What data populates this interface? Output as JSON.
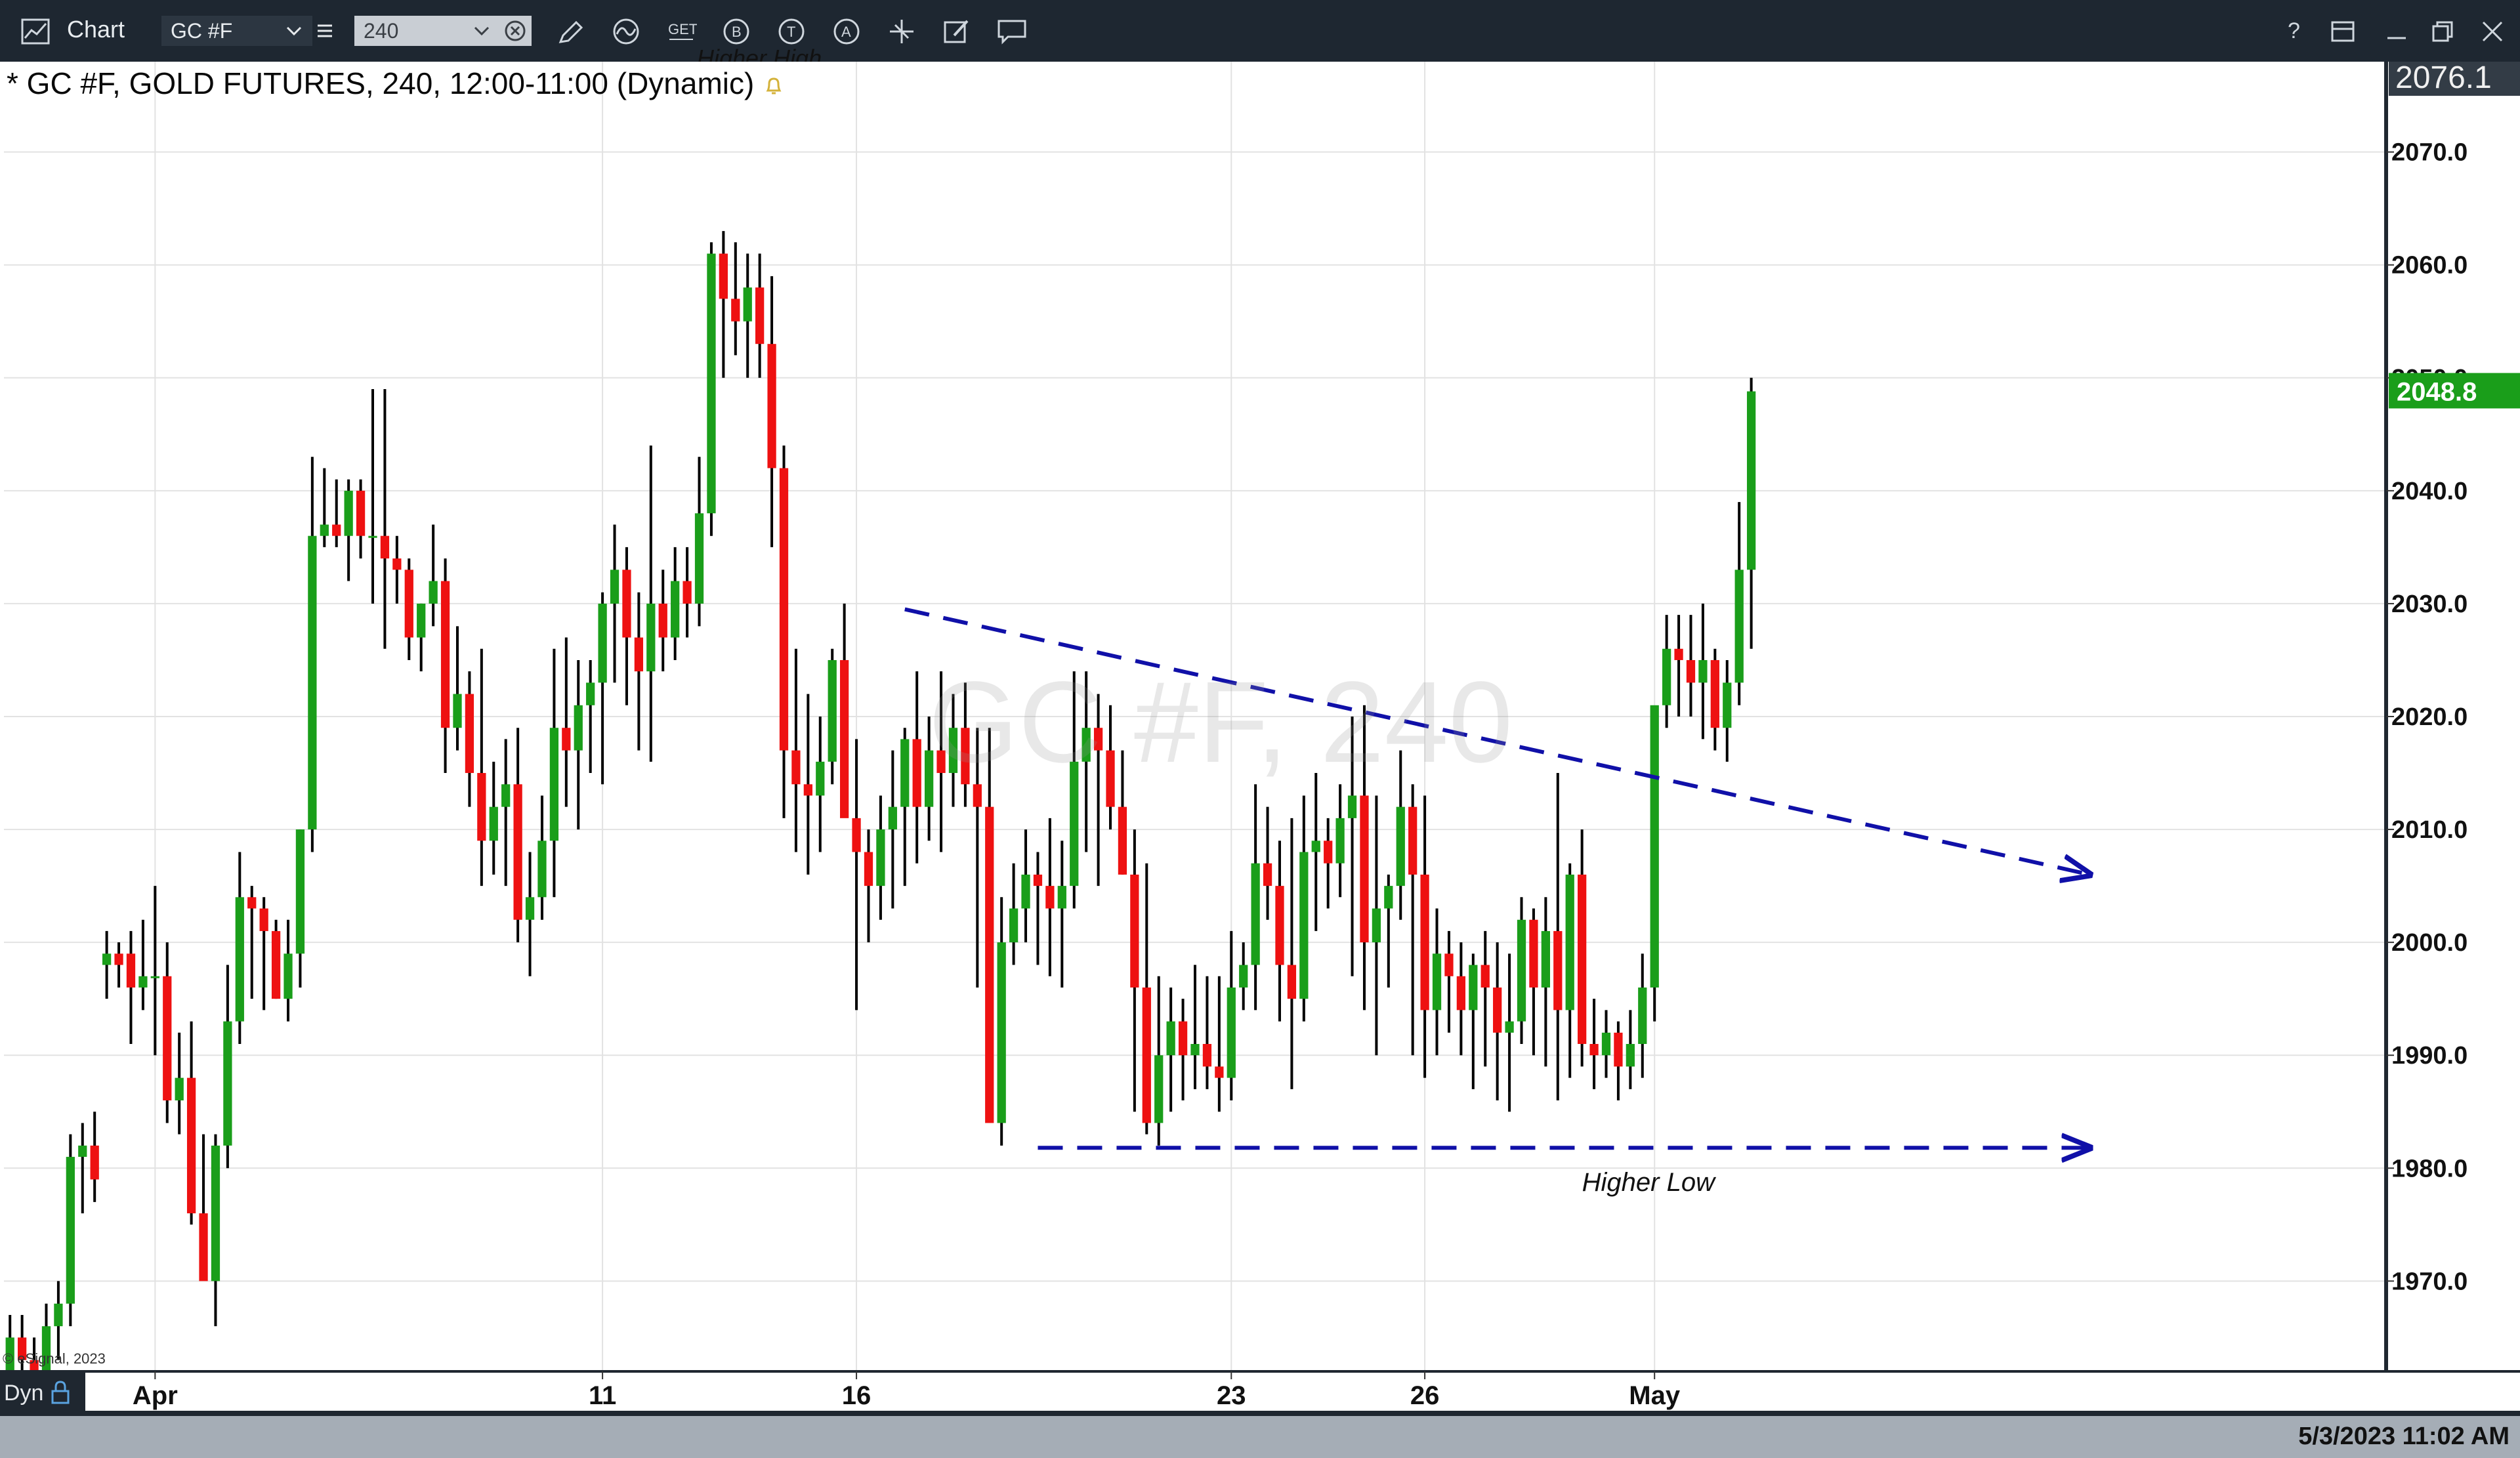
{
  "toolbar": {
    "title": "Chart",
    "symbol": "GC #F",
    "interval": "240",
    "tools": [
      "pencil-icon",
      "wave-icon",
      "get-icon",
      "b-circle-icon",
      "t-circle-icon",
      "a-circle-icon",
      "crosshair-icon",
      "edit-icon",
      "comment-icon"
    ],
    "get_label": "GET",
    "b_label": "B",
    "t_label": "T",
    "a_label": "A",
    "help_label": "?"
  },
  "chart_title": "* GC #F, GOLD FUTURES, 240, 12:00-11:00 (Dynamic)",
  "cutoff_annotation": "Higher High",
  "watermark": "GC #F, 240",
  "copyright": "© eSignal, 2023",
  "dyn_label": "Dyn",
  "timestamp": "5/3/2023 11:02 AM",
  "chart_data": {
    "type": "candlestick",
    "timeframe": "240",
    "price_axis": {
      "ylim": [
        1962,
        2078
      ],
      "ticks": [
        "1970.0",
        "1980.0",
        "1990.0",
        "2000.0",
        "2010.0",
        "2020.0",
        "2030.0",
        "2040.0",
        "2050.0",
        "2060.0",
        "2070.0"
      ],
      "top_partial_label": "2076.1",
      "last_price_label": "2048.8",
      "last_price": 2048.8
    },
    "x_axis": {
      "labels": [
        {
          "text": "Apr",
          "bar": 12
        },
        {
          "text": "11",
          "bar": 49
        },
        {
          "text": "16",
          "bar": 70
        },
        {
          "text": "23",
          "bar": 101
        },
        {
          "text": "26",
          "bar": 117
        },
        {
          "text": "May",
          "bar": 136
        }
      ],
      "total_slots": 197
    },
    "colors": {
      "up": "#1a9e1a",
      "down": "#ee1111",
      "wick": "#000000",
      "trendline": "#1010a8",
      "last_price_bg": "#1a9e1a"
    },
    "candles": [
      [
        1962,
        1967,
        1961,
        1965
      ],
      [
        1965,
        1967,
        1962,
        1963
      ],
      [
        1963,
        1965,
        1960,
        1962
      ],
      [
        1962,
        1968,
        1960,
        1966
      ],
      [
        1966,
        1970,
        1963,
        1968
      ],
      [
        1968,
        1983,
        1966,
        1981
      ],
      [
        1981,
        1984,
        1976,
        1982
      ],
      [
        1982,
        1985,
        1977,
        1979
      ],
      [
        1998,
        2001,
        1995,
        1999
      ],
      [
        1999,
        2000,
        1996,
        1998
      ],
      [
        1999,
        2001,
        1991,
        1996
      ],
      [
        1996,
        2002,
        1994,
        1997
      ],
      [
        1997,
        2005,
        1990,
        1997
      ],
      [
        1997,
        2000,
        1984,
        1986
      ],
      [
        1986,
        1992,
        1983,
        1988
      ],
      [
        1988,
        1993,
        1975,
        1976
      ],
      [
        1976,
        1983,
        1972,
        1970
      ],
      [
        1970,
        1983,
        1966,
        1982
      ],
      [
        1982,
        1998,
        1980,
        1993
      ],
      [
        1993,
        2008,
        1991,
        2004
      ],
      [
        2004,
        2005,
        1995,
        2003
      ],
      [
        2003,
        2004,
        1994,
        2001
      ],
      [
        2001,
        2002,
        1995,
        1995
      ],
      [
        1995,
        2002,
        1993,
        1999
      ],
      [
        1999,
        2010,
        1996,
        2010
      ],
      [
        2010,
        2043,
        2008,
        2036
      ],
      [
        2036,
        2042,
        2035,
        2037
      ],
      [
        2037,
        2041,
        2035,
        2036
      ],
      [
        2036,
        2041,
        2032,
        2040
      ],
      [
        2040,
        2041,
        2034,
        2036
      ],
      [
        2036,
        2049,
        2030,
        2036
      ],
      [
        2036,
        2049,
        2026,
        2034
      ],
      [
        2034,
        2036,
        2030,
        2033
      ],
      [
        2033,
        2034,
        2025,
        2027
      ],
      [
        2027,
        2030,
        2024,
        2030
      ],
      [
        2030,
        2037,
        2028,
        2032
      ],
      [
        2032,
        2034,
        2015,
        2019
      ],
      [
        2019,
        2028,
        2017,
        2022
      ],
      [
        2022,
        2024,
        2012,
        2015
      ],
      [
        2015,
        2026,
        2005,
        2009
      ],
      [
        2009,
        2016,
        2006,
        2012
      ],
      [
        2012,
        2018,
        2005,
        2014
      ],
      [
        2014,
        2019,
        2000,
        2002
      ],
      [
        2002,
        2008,
        1997,
        2004
      ],
      [
        2004,
        2013,
        2002,
        2009
      ],
      [
        2009,
        2026,
        2004,
        2019
      ],
      [
        2019,
        2027,
        2012,
        2017
      ],
      [
        2017,
        2025,
        2010,
        2021
      ],
      [
        2021,
        2025,
        2015,
        2023
      ],
      [
        2023,
        2031,
        2014,
        2030
      ],
      [
        2030,
        2037,
        2023,
        2033
      ],
      [
        2033,
        2035,
        2021,
        2027
      ],
      [
        2027,
        2031,
        2017,
        2024
      ],
      [
        2024,
        2044,
        2016,
        2030
      ],
      [
        2030,
        2033,
        2024,
        2027
      ],
      [
        2027,
        2035,
        2025,
        2032
      ],
      [
        2032,
        2035,
        2027,
        2030
      ],
      [
        2030,
        2043,
        2028,
        2038
      ],
      [
        2038,
        2062,
        2036,
        2061
      ],
      [
        2061,
        2063,
        2050,
        2057
      ],
      [
        2057,
        2062,
        2052,
        2055
      ],
      [
        2055,
        2061,
        2050,
        2058
      ],
      [
        2058,
        2061,
        2050,
        2053
      ],
      [
        2053,
        2059,
        2035,
        2042
      ],
      [
        2042,
        2044,
        2011,
        2017
      ],
      [
        2017,
        2026,
        2008,
        2014
      ],
      [
        2014,
        2022,
        2006,
        2013
      ],
      [
        2013,
        2020,
        2008,
        2016
      ],
      [
        2016,
        2026,
        2014,
        2025
      ],
      [
        2025,
        2030,
        2015,
        2011
      ],
      [
        2011,
        2018,
        1994,
        2008
      ],
      [
        2008,
        2010,
        2000,
        2005
      ],
      [
        2005,
        2013,
        2002,
        2010
      ],
      [
        2010,
        2017,
        2003,
        2012
      ],
      [
        2012,
        2019,
        2005,
        2018
      ],
      [
        2018,
        2024,
        2007,
        2012
      ],
      [
        2012,
        2020,
        2009,
        2017
      ],
      [
        2017,
        2024,
        2008,
        2015
      ],
      [
        2015,
        2022,
        2012,
        2019
      ],
      [
        2019,
        2023,
        2012,
        2014
      ],
      [
        2014,
        2019,
        1996,
        2012
      ],
      [
        2012,
        2019,
        1985,
        1984
      ],
      [
        1984,
        2004,
        1982,
        2000
      ],
      [
        2000,
        2007,
        1998,
        2003
      ],
      [
        2003,
        2010,
        2000,
        2006
      ],
      [
        2006,
        2008,
        1998,
        2005
      ],
      [
        2005,
        2011,
        1997,
        2003
      ],
      [
        2003,
        2009,
        1996,
        2005
      ],
      [
        2005,
        2024,
        2003,
        2016
      ],
      [
        2016,
        2024,
        2008,
        2019
      ],
      [
        2019,
        2022,
        2005,
        2017
      ],
      [
        2017,
        2021,
        2010,
        2012
      ],
      [
        2012,
        2017,
        2006,
        2006
      ],
      [
        2006,
        2010,
        1985,
        1996
      ],
      [
        1996,
        2007,
        1983,
        1984
      ],
      [
        1984,
        1997,
        1982,
        1990
      ],
      [
        1990,
        1996,
        1985,
        1993
      ],
      [
        1993,
        1995,
        1986,
        1990
      ],
      [
        1990,
        1998,
        1987,
        1991
      ],
      [
        1991,
        1997,
        1987,
        1989
      ],
      [
        1989,
        1997,
        1985,
        1988
      ],
      [
        1988,
        2001,
        1986,
        1996
      ],
      [
        1996,
        2000,
        1994,
        1998
      ],
      [
        1998,
        2014,
        1994,
        2007
      ],
      [
        2007,
        2012,
        2002,
        2005
      ],
      [
        2005,
        2009,
        1993,
        1998
      ],
      [
        1998,
        2011,
        1987,
        1995
      ],
      [
        1995,
        2013,
        1993,
        2008
      ],
      [
        2008,
        2015,
        2001,
        2009
      ],
      [
        2009,
        2011,
        2003,
        2007
      ],
      [
        2007,
        2014,
        2004,
        2011
      ],
      [
        2011,
        2020,
        1997,
        2013
      ],
      [
        2013,
        2021,
        1994,
        2000
      ],
      [
        2000,
        2013,
        1990,
        2003
      ],
      [
        2003,
        2006,
        1996,
        2005
      ],
      [
        2005,
        2017,
        2002,
        2012
      ],
      [
        2012,
        2014,
        1990,
        2006
      ],
      [
        2006,
        2013,
        1988,
        1994
      ],
      [
        1994,
        2003,
        1990,
        1999
      ],
      [
        1999,
        2001,
        1992,
        1997
      ],
      [
        1997,
        2000,
        1990,
        1994
      ],
      [
        1994,
        1999,
        1987,
        1998
      ],
      [
        1998,
        2001,
        1989,
        1996
      ],
      [
        1996,
        2000,
        1986,
        1992
      ],
      [
        1992,
        1999,
        1985,
        1993
      ],
      [
        1993,
        2004,
        1991,
        2002
      ],
      [
        2002,
        2003,
        1990,
        1996
      ],
      [
        1996,
        2004,
        1989,
        2001
      ],
      [
        2001,
        2015,
        1986,
        1994
      ],
      [
        1994,
        2007,
        1988,
        2006
      ],
      [
        2006,
        2010,
        1989,
        1991
      ],
      [
        1991,
        1995,
        1987,
        1990
      ],
      [
        1990,
        1994,
        1988,
        1992
      ],
      [
        1992,
        1993,
        1986,
        1989
      ],
      [
        1989,
        1994,
        1987,
        1991
      ],
      [
        1991,
        1999,
        1988,
        1996
      ],
      [
        1996,
        2003,
        1993,
        2021
      ],
      [
        2021,
        2029,
        2019,
        2026
      ],
      [
        2026,
        2029,
        2020,
        2025
      ],
      [
        2025,
        2029,
        2020,
        2023
      ],
      [
        2023,
        2030,
        2018,
        2025
      ],
      [
        2025,
        2026,
        2017,
        2019
      ],
      [
        2019,
        2025,
        2016,
        2023
      ],
      [
        2023,
        2039,
        2021,
        2033
      ],
      [
        2033,
        2050,
        2026,
        2048.8
      ]
    ],
    "candles_format": "[open, high, low, close]",
    "trendlines": [
      {
        "name": "descending-resistance",
        "style": "dashed",
        "start": {
          "bar": 74,
          "price": 2029.5
        },
        "end": {
          "bar": 172,
          "price": 2006
        }
      },
      {
        "name": "horizontal-support",
        "style": "dashed",
        "start": {
          "bar": 85,
          "price": 1981.8
        },
        "end": {
          "bar": 172,
          "price": 1981.8
        }
      }
    ],
    "annotations": [
      {
        "text": "Higher Low",
        "bar": 130,
        "price": 1979.6
      }
    ]
  }
}
